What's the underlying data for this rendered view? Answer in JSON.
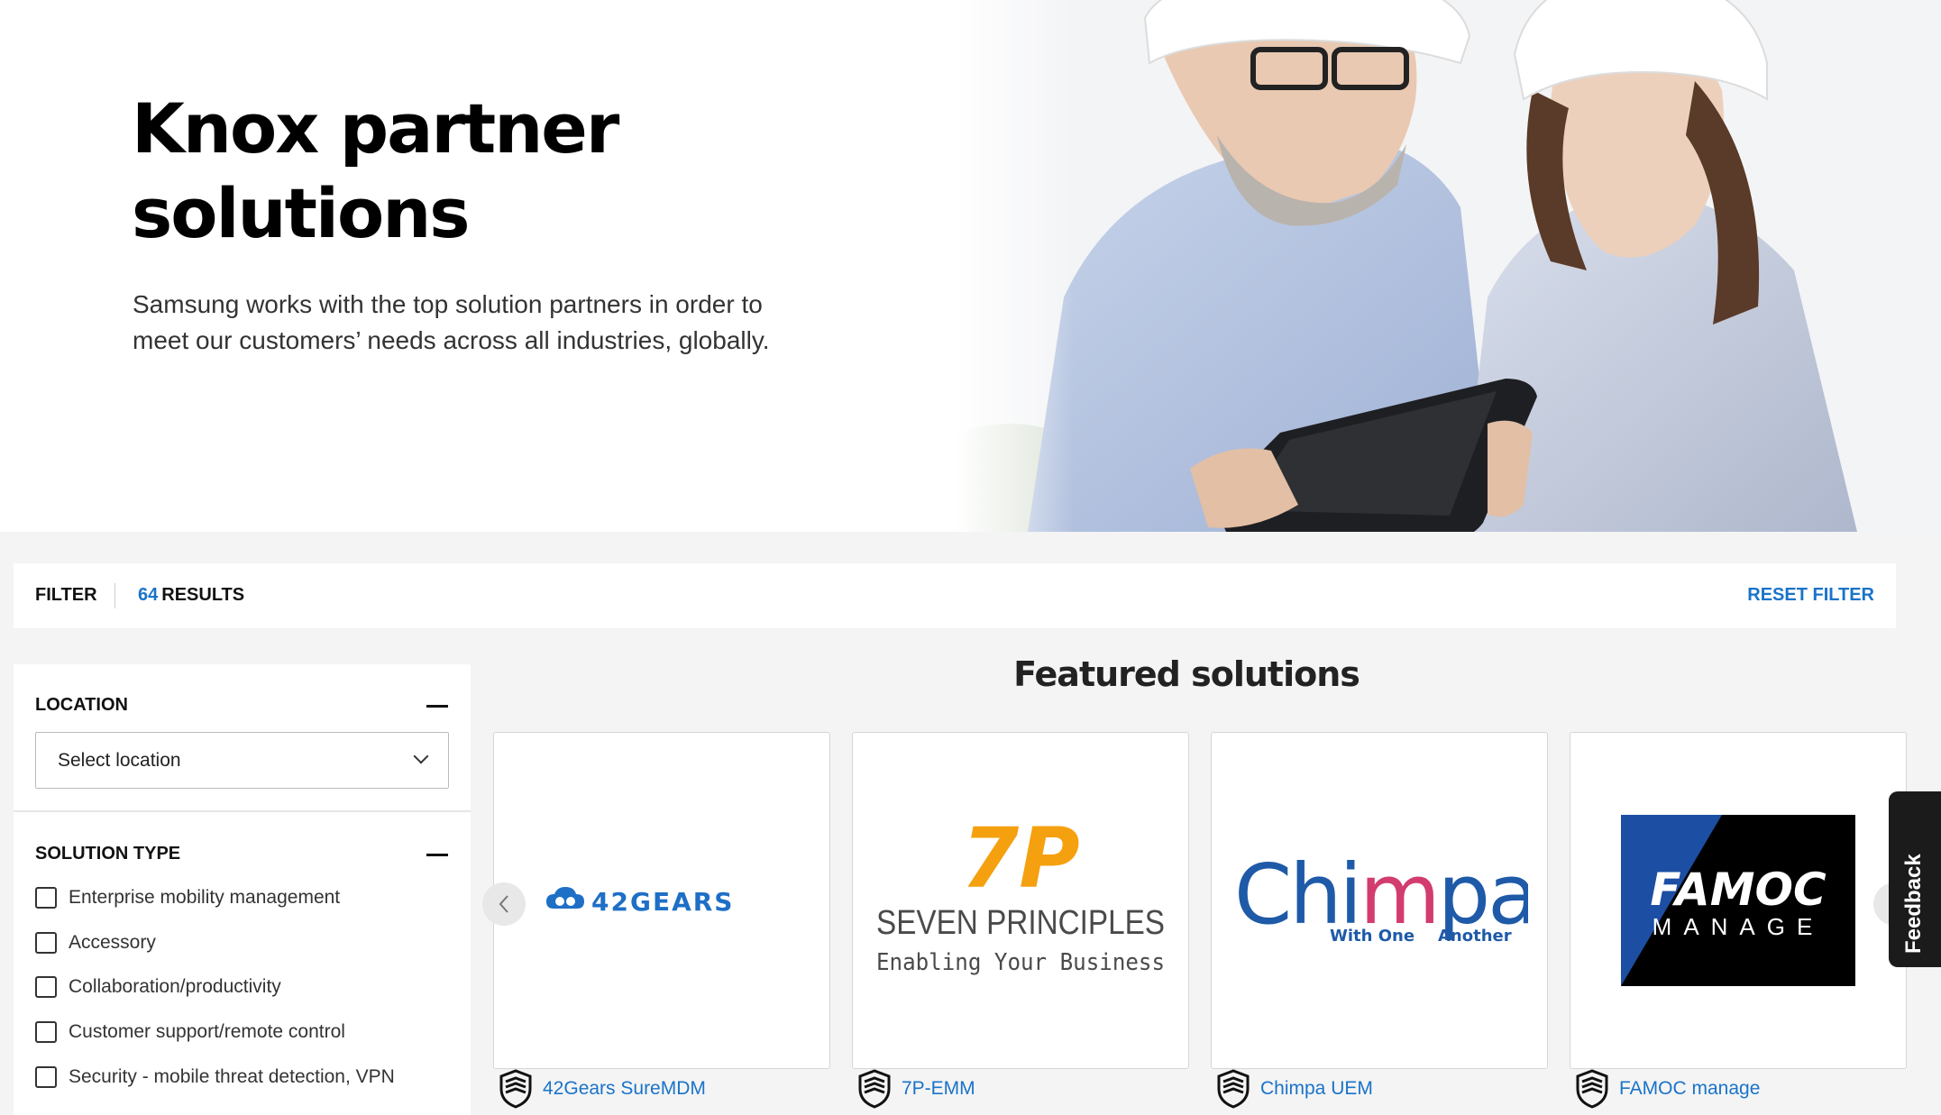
{
  "hero": {
    "title_line1": "Knox partner",
    "title_line2": "solutions",
    "description_line1": "Samsung works with the top solution partners in order to",
    "description_line2": "meet our customers’ needs across all industries, globally."
  },
  "filter_bar": {
    "filter_label": "FILTER",
    "results_count": "64",
    "results_label": "RESULTS",
    "reset_label": "RESET FILTER"
  },
  "sidebar": {
    "location": {
      "heading": "LOCATION",
      "select_value": "Select location"
    },
    "solution_type": {
      "heading": "SOLUTION TYPE",
      "options": [
        "Enterprise mobility management",
        "Accessory",
        "Collaboration/productivity",
        "Customer support/remote control",
        "Security - mobile threat detection, VPN"
      ]
    }
  },
  "featured": {
    "title": "Featured solutions",
    "cards": [
      {
        "name": "42Gears SureMDM",
        "logo_text": "42GEARS",
        "brand_color": "#1e6fc6"
      },
      {
        "name": "7P-EMM",
        "logo_mark": "7P",
        "logo_line1": "SEVEN PRINCIPLES",
        "logo_line2": "Enabling Your Business",
        "brand_color": "#f5a00f"
      },
      {
        "name": "Chimpa UEM",
        "logo_text_a": "Chi",
        "logo_text_b": "m",
        "logo_text_c": "pa",
        "logo_tagline_a": "With One",
        "logo_tagline_b": "Another",
        "brand_color": "#1e5aa8"
      },
      {
        "name": "FAMOC manage",
        "logo_line1": "FAMOC",
        "logo_line2": "MANAGE",
        "brand_color": "#1c4fa3"
      }
    ]
  },
  "feedback": {
    "label": "Feedback"
  },
  "icons": {
    "shield": "knox-shield-icon",
    "chevron": "chevron-down-icon",
    "collapse": "minus-icon",
    "prev": "chevron-left-icon"
  }
}
